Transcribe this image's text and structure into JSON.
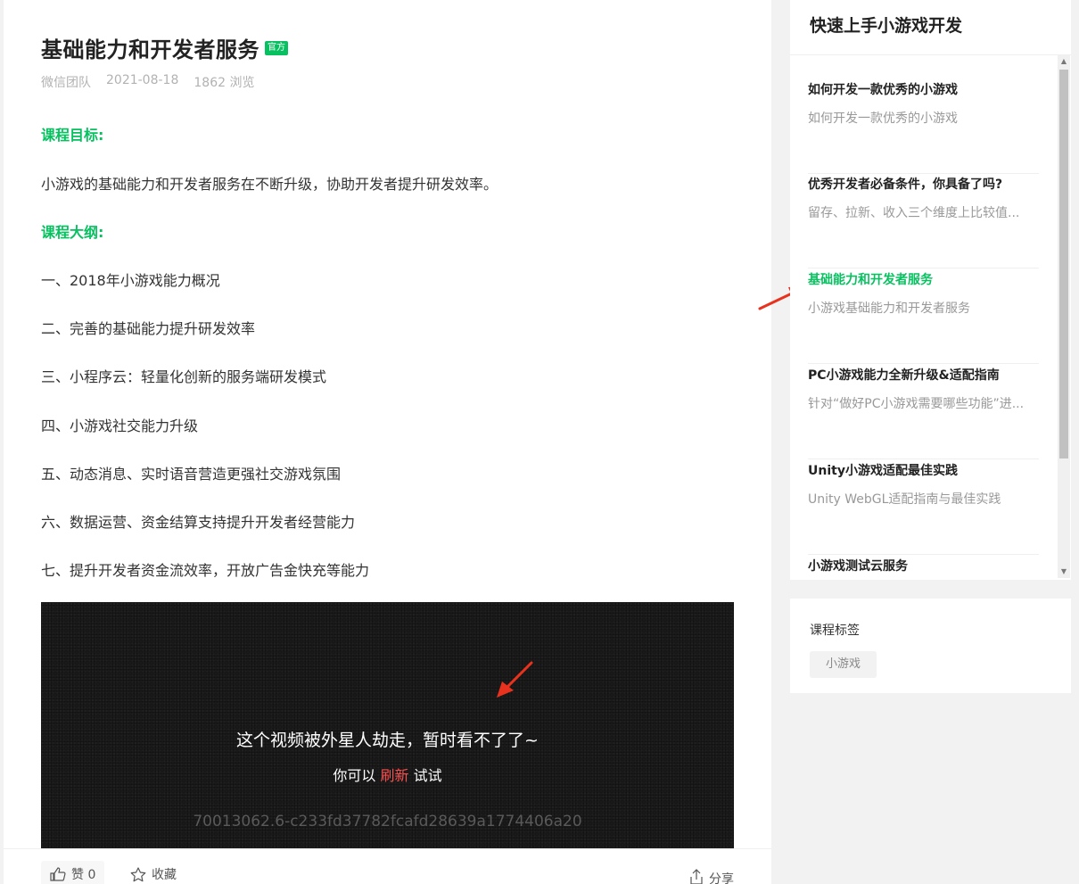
{
  "article": {
    "title": "基础能力和开发者服务",
    "badge": "官方",
    "author": "微信团队",
    "date": "2021-08-18",
    "views": "1862 浏览",
    "goal_heading": "课程目标:",
    "goal_text": "小游戏的基础能力和开发者服务在不断升级，协助开发者提升研发效率。",
    "outline_heading": "课程大纲:",
    "outline": [
      "一、2018年小游戏能力概况",
      "二、完善的基础能力提升研发效率",
      "三、小程序云：轻量化创新的服务端研发模式",
      "四、小游戏社交能力升级",
      "五、动态消息、实时语音营造更强社交游戏氛围",
      "六、数据运营、资金结算支持提升开发者经营能力",
      "七、提升开发者资金流效率，开放广告金快充等能力"
    ]
  },
  "video": {
    "error_message": "这个视频被外星人劫走，暂时看不了了~",
    "retry_prefix": "你可以",
    "retry_link": "刷新",
    "retry_suffix": "试试",
    "error_id": "70013062.6-c233fd37782fcafd28639a1774406a20"
  },
  "actions": {
    "like_label": "赞 0",
    "favorite_label": "收藏",
    "share_label": "分享"
  },
  "sidebar": {
    "title": "快速上手小游戏开发",
    "items": [
      {
        "title": "如何开发一款优秀的小游戏",
        "desc": "如何开发一款优秀的小游戏",
        "active": false
      },
      {
        "title": "优秀开发者必备条件，你具备了吗?",
        "desc": "留存、拉新、收入三个维度上比较值...",
        "active": false
      },
      {
        "title": "基础能力和开发者服务",
        "desc": "小游戏基础能力和开发者服务",
        "active": true
      },
      {
        "title": "PC小游戏能力全新升级&适配指南",
        "desc": "针对“做好PC小游戏需要哪些功能”进...",
        "active": false
      },
      {
        "title": "Unity小游戏适配最佳实践",
        "desc": "Unity WebGL适配指南与最佳实践",
        "active": false
      },
      {
        "title": "小游戏测试云服务",
        "desc": "",
        "active": false
      }
    ]
  },
  "tags": {
    "title": "课程标签",
    "items": [
      "小游戏"
    ]
  },
  "colors": {
    "accent": "#07c160",
    "link_red": "#fa5151",
    "arrow_red": "#e8321e"
  },
  "icons": {
    "like": "thumbs-up-icon",
    "favorite": "star-icon",
    "share": "share-icon"
  }
}
